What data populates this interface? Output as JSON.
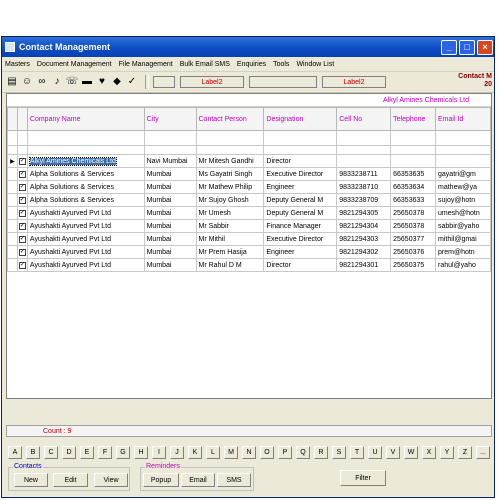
{
  "window": {
    "title": "Contact Management",
    "corner_line1": "Contact M",
    "corner_line2": "20"
  },
  "menu": [
    "Masters",
    "Document Management",
    "File Management",
    "Bulk Email SMS",
    "Enquiries",
    "Tools",
    "Window List"
  ],
  "toolbar": {
    "icons": [
      "save-icon",
      "user-icon",
      "binoculars-icon",
      "speaker-icon",
      "phone-icon",
      "car-icon",
      "heart-icon",
      "tag-icon",
      "spellcheck-icon"
    ],
    "label1": "Label2",
    "label2": "Label2"
  },
  "grid": {
    "banner": "Alkyl Amines Chemicals Ltd",
    "columns": [
      "Company Name",
      "City",
      "Contact Person",
      "Designation",
      "Cell No",
      "Telephone",
      "Email Id"
    ],
    "rows": [
      [
        "Alkyl Amines Chemicals Ltd",
        "Navi Mumbai",
        "Mr Mitesh Gandhi",
        "Director",
        "",
        "",
        ""
      ],
      [
        "Alpha Solutions & Services",
        "Mumbai",
        "Ms Gayatri Singh",
        "Executive Director",
        "9833238711",
        "66353635",
        "gayatri@gm"
      ],
      [
        "Alpha Solutions & Services",
        "Mumbai",
        "Mr Mathew Philip",
        "Engineer",
        "9833238710",
        "66353634",
        "mathew@ya"
      ],
      [
        "Alpha Solutions & Services",
        "Mumbai",
        "Mr Sujoy Ghosh",
        "Deputy General M",
        "9833238709",
        "66353633",
        "sujoy@hotn"
      ],
      [
        "Ayushakti Ayurved Pvt Ltd",
        "Mumbai",
        "Mr Umesh",
        "Deputy General M",
        "9821294305",
        "25650378",
        "umesh@hotn"
      ],
      [
        "Ayushakti Ayurved Pvt Ltd",
        "Mumbai",
        "Mr Sabbir",
        "Finance Manager",
        "9821294304",
        "25650378",
        "sabbir@yaho"
      ],
      [
        "Ayushakti Ayurved Pvt Ltd",
        "Mumbai",
        "Mr Mithil",
        "Executive Director",
        "9821294303",
        "25650377",
        "mithil@gmai"
      ],
      [
        "Ayushakti Ayurved Pvt Ltd",
        "Mumbai",
        "Mr Prem Hasija",
        "Engineer",
        "9821294302",
        "25650376",
        "prem@hotn"
      ],
      [
        "Ayushakti Ayurved Pvt Ltd",
        "Mumbai",
        "Mr Rahul D M",
        "Director",
        "9821294301",
        "25650375",
        "rahul@yaho"
      ]
    ],
    "count": "Count : 9"
  },
  "alphabet": [
    "A",
    "B",
    "C",
    "D",
    "E",
    "F",
    "G",
    "H",
    "I",
    "J",
    "K",
    "L",
    "M",
    "N",
    "O",
    "P",
    "Q",
    "R",
    "S",
    "T",
    "U",
    "V",
    "W",
    "X",
    "Y",
    "Z",
    "..."
  ],
  "contacts": {
    "legend": "Contacts",
    "new": "New",
    "edit": "Edit",
    "view": "View"
  },
  "reminders": {
    "legend": "Reminders",
    "popup": "Popup",
    "email": "Email",
    "sms": "SMS"
  },
  "filter": "Filter"
}
